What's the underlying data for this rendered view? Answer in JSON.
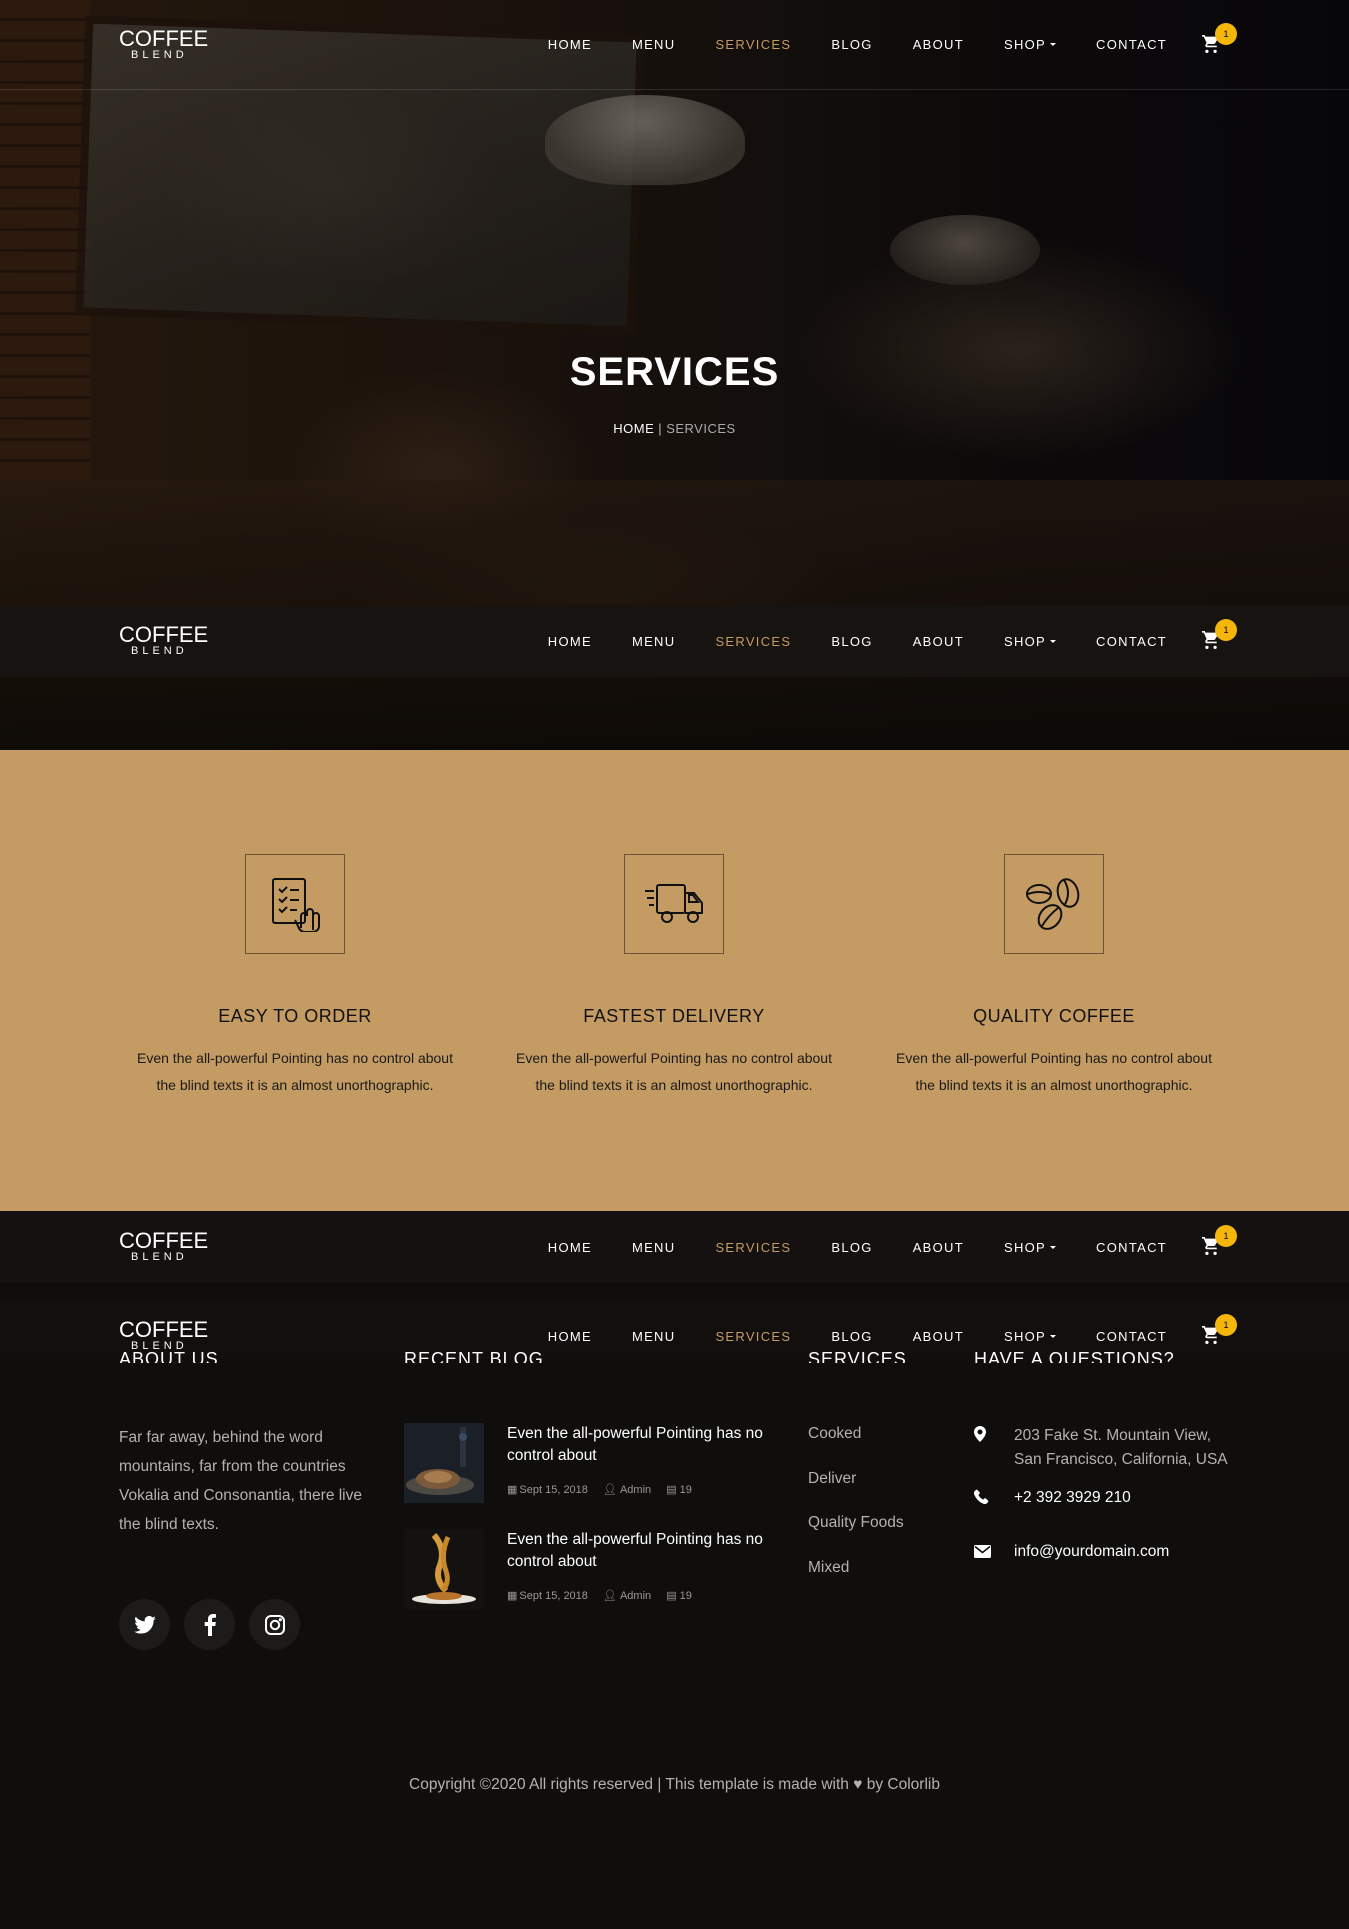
{
  "brand": {
    "line1": "COFFEE",
    "line2": "BLEND"
  },
  "nav": {
    "items": [
      {
        "label": "HOME",
        "active": false
      },
      {
        "label": "MENU",
        "active": false
      },
      {
        "label": "SERVICES",
        "active": true
      },
      {
        "label": "BLOG",
        "active": false
      },
      {
        "label": "ABOUT",
        "active": false
      },
      {
        "label": "SHOP",
        "active": false,
        "dropdown": true
      },
      {
        "label": "CONTACT",
        "active": false
      }
    ],
    "cart_count": "1"
  },
  "hero": {
    "title": "SERVICES",
    "breadcrumb": {
      "home": "HOME",
      "current": "SERVICES"
    }
  },
  "services": [
    {
      "icon": "order-checklist-icon",
      "title": "EASY TO ORDER",
      "text": "Even the all-powerful Pointing has no control about the blind texts it is an almost unorthographic."
    },
    {
      "icon": "delivery-truck-icon",
      "title": "FASTEST DELIVERY",
      "text": "Even the all-powerful Pointing has no control about the blind texts it is an almost unorthographic."
    },
    {
      "icon": "coffee-beans-icon",
      "title": "QUALITY COFFEE",
      "text": "Even the all-powerful Pointing has no control about the blind texts it is an almost unorthographic."
    }
  ],
  "footer": {
    "headings": {
      "about": "ABOUT US",
      "blog": "RECENT BLOG",
      "services": "SERVICES",
      "questions": "HAVE A QUESTIONS?"
    },
    "about_text": "Far far away, behind the word mountains, far from the countries Vokalia and Consonantia, there live the blind texts.",
    "social": [
      "twitter-icon",
      "facebook-icon",
      "instagram-icon"
    ],
    "posts": [
      {
        "title": "Even the all-powerful Pointing has no control about",
        "date": "Sept 15, 2018",
        "author": "Admin",
        "comments": "19"
      },
      {
        "title": "Even the all-powerful Pointing has no control about",
        "date": "Sept 15, 2018",
        "author": "Admin",
        "comments": "19"
      }
    ],
    "service_links": [
      "Cooked",
      "Deliver",
      "Quality Foods",
      "Mixed"
    ],
    "contact": {
      "address": "203 Fake St. Mountain View, San Francisco, California, USA",
      "phone": "+2 392 3929 210",
      "email": "info@yourdomain.com"
    },
    "copyright_pre": "Copyright ©2020 All rights reserved | This template is made with",
    "copyright_post": "by Colorlib"
  },
  "colors": {
    "accent": "#c49b63",
    "badge": "#f5b60a",
    "footer_bg": "#0f0e0d"
  }
}
